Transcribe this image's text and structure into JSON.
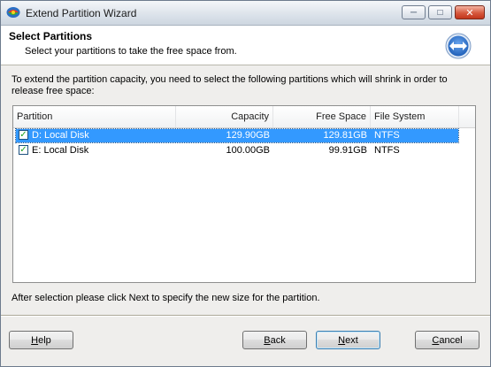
{
  "window": {
    "title": "Extend Partition Wizard",
    "controls": {
      "minimize": "minimize-icon",
      "maximize": "maximize-icon",
      "close": "close-icon"
    }
  },
  "header": {
    "title": "Select Partitions",
    "subtitle": "Select your partitions to take the free space from."
  },
  "instruction": "To extend the partition capacity, you need to select the following partitions which will shrink in order to release free space:",
  "table": {
    "columns": [
      "Partition",
      "Capacity",
      "Free Space",
      "File System"
    ],
    "rows": [
      {
        "name": "D: Local Disk",
        "capacity": "129.90GB",
        "free": "129.81GB",
        "fs": "NTFS",
        "checked": true,
        "selected": true
      },
      {
        "name": "E: Local Disk",
        "capacity": "100.00GB",
        "free": "99.91GB",
        "fs": "NTFS",
        "checked": true,
        "selected": false
      }
    ]
  },
  "footer_note": "After selection please click Next to specify the new size for the partition.",
  "buttons": {
    "help": {
      "mnemonic": "H",
      "rest": "elp"
    },
    "back": {
      "mnemonic": "B",
      "rest": "ack"
    },
    "next": {
      "mnemonic": "N",
      "rest": "ext"
    },
    "cancel": {
      "mnemonic": "C",
      "rest": "ancel"
    }
  },
  "colors": {
    "selection": "#3399ff",
    "checkmark": "#21a121",
    "header_icon_blue": "#1f5fb8"
  }
}
